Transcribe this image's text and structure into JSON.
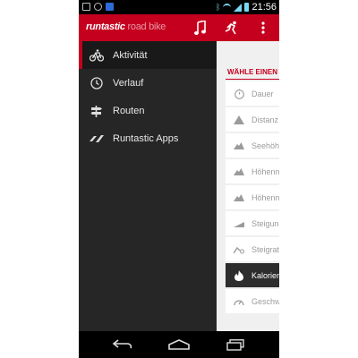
{
  "status_bar": {
    "time": "21:56",
    "notification_icons": [
      "image-icon",
      "voicemail-icon",
      "message-icon"
    ],
    "system_icons": [
      "bluetooth-icon",
      "wifi-icon",
      "signal-icon",
      "battery-icon"
    ]
  },
  "action_bar": {
    "logo_main": "runtastic",
    "logo_sub": "road bike",
    "actions": [
      "music-icon",
      "sport-type-icon",
      "overflow-menu-icon"
    ]
  },
  "drawer": {
    "items": [
      {
        "label": "Aktivität",
        "icon": "bike-icon",
        "active": true
      },
      {
        "label": "Verlauf",
        "icon": "clock-icon",
        "active": false
      },
      {
        "label": "Routen",
        "icon": "signpost-icon",
        "active": false
      },
      {
        "label": "Runtastic Apps",
        "icon": "apps-icon",
        "active": false
      }
    ]
  },
  "content": {
    "header": "WÄHLE EINEN",
    "items": [
      {
        "label": "Dauer",
        "icon": "stopwatch-icon",
        "selected": false
      },
      {
        "label": "Distanz",
        "icon": "distance-icon",
        "selected": false
      },
      {
        "label": "Seehöhe",
        "icon": "mountain-icon",
        "selected": false
      },
      {
        "label": "Höhenm",
        "icon": "elevation-gain-icon",
        "selected": false
      },
      {
        "label": "Höhenm",
        "icon": "elevation-loss-icon",
        "selected": false
      },
      {
        "label": "Steigung",
        "icon": "slope-icon",
        "selected": false
      },
      {
        "label": "Steigrat",
        "icon": "climb-rate-icon",
        "selected": false
      },
      {
        "label": "Kalorien",
        "icon": "flame-icon",
        "selected": true
      },
      {
        "label": "Geschwi",
        "icon": "speedometer-icon",
        "selected": false
      }
    ]
  },
  "colors": {
    "accent": "#c5001f",
    "drawer_bg": "#262626",
    "content_bg": "#f0f0f0",
    "selected_bg": "#2d2d2d"
  },
  "nav_bar": {
    "buttons": [
      "back-icon",
      "home-icon",
      "recent-apps-icon"
    ]
  }
}
